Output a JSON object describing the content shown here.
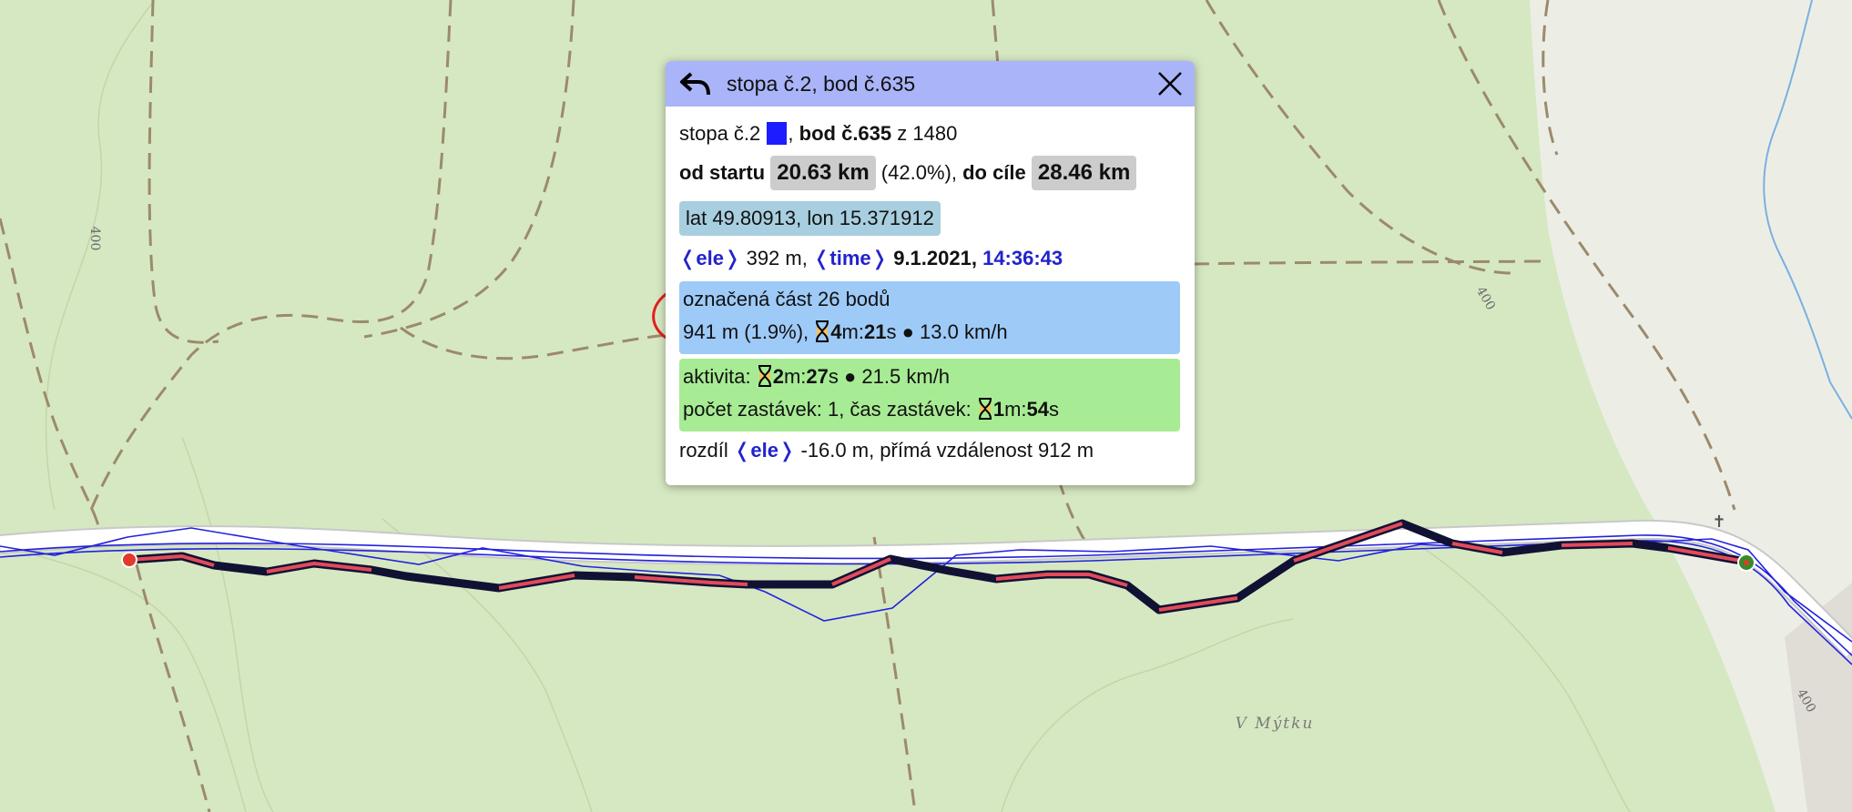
{
  "map": {
    "place_label": "V Mýtku",
    "contour_labels": [
      "400",
      "400",
      "400"
    ],
    "cross_symbol": "✝",
    "colors": {
      "background": "#d6e8c2",
      "road": "#ffffff",
      "path": "#9c8a6c",
      "track_blue": "#2222dd",
      "track_selected": "#e24a5a",
      "track_dark": "#111133",
      "start_marker": "#e23a2a",
      "end_marker": "#3a8a2a",
      "stream": "#7ab0e0",
      "annotation": "#e02020"
    }
  },
  "popup": {
    "title": "stopa č.2, bod č.635",
    "back_icon": "back-arrow-icon",
    "close_icon": "close-icon",
    "track_line": {
      "track": "stopa č.2",
      "sep": ",",
      "point_label": "bod č.635",
      "of": "z 1480",
      "swatch_color": "#1c1cff"
    },
    "distance_line": {
      "from_start_label": "od startu",
      "from_start_value": "20.63 km",
      "percent": "(42.0%),",
      "to_end_label": "do cíle",
      "to_end_value": "28.46 km"
    },
    "coords": "lat 49.80913, lon 15.371912",
    "ele_line": {
      "ele_tag": "❬ele❭",
      "ele_value": "392 m,",
      "time_tag": "❬time❭",
      "date": "9.1.2021,",
      "time": "14:36:43"
    },
    "selection": {
      "line1": "označená část 26 bodů",
      "line2_prefix": "941 m (1.9%),",
      "dur_m": "4",
      "m_unit": "m:",
      "dur_s": "21",
      "s_unit": "s",
      "speed": "● 13.0 km/h"
    },
    "activity": {
      "label": "aktivita:",
      "dur_m": "2",
      "m_unit": "m:",
      "dur_s": "27",
      "s_unit": "s",
      "speed": "● 21.5 km/h",
      "stops_label": "počet zastávek: 1, čas zastávek:",
      "stop_m": "1",
      "stop_s": "54"
    },
    "diff": {
      "label": "rozdíl",
      "ele_tag": "❬ele❭",
      "rest": "-16.0 m, přímá vzdálenost 912 m"
    }
  }
}
